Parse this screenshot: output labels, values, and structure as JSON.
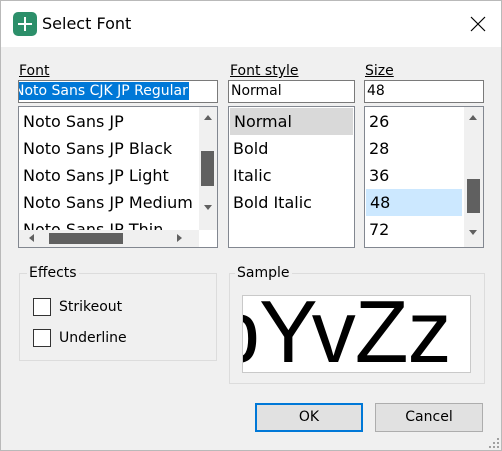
{
  "window": {
    "title": "Select Font"
  },
  "font": {
    "label": "Font",
    "value": "Noto Sans CJK JP Regular",
    "items": [
      "Noto Sans JP",
      "Noto Sans JP Black",
      "Noto Sans JP Light",
      "Noto Sans JP Medium",
      "Noto Sans JP Thin"
    ]
  },
  "style": {
    "label": "Font style",
    "value": "Normal",
    "items": [
      "Normal",
      "Bold",
      "Italic",
      "Bold Italic"
    ],
    "selected": "Normal"
  },
  "size": {
    "label": "Size",
    "value": "48",
    "items": [
      "26",
      "28",
      "36",
      "48",
      "72"
    ],
    "selected": "48"
  },
  "effects": {
    "label": "Effects",
    "strikeout": {
      "label": "Strikeout",
      "checked": false
    },
    "underline": {
      "label": "Underline",
      "checked": false
    }
  },
  "sample": {
    "label": "Sample",
    "text": "bYvZz"
  },
  "buttons": {
    "ok": "OK",
    "cancel": "Cancel"
  },
  "colors": {
    "selection": "#0078d7",
    "selection_light": "#cce8ff",
    "inactive_selection": "#d9d9d9",
    "app_icon": "#2c8f6a"
  }
}
